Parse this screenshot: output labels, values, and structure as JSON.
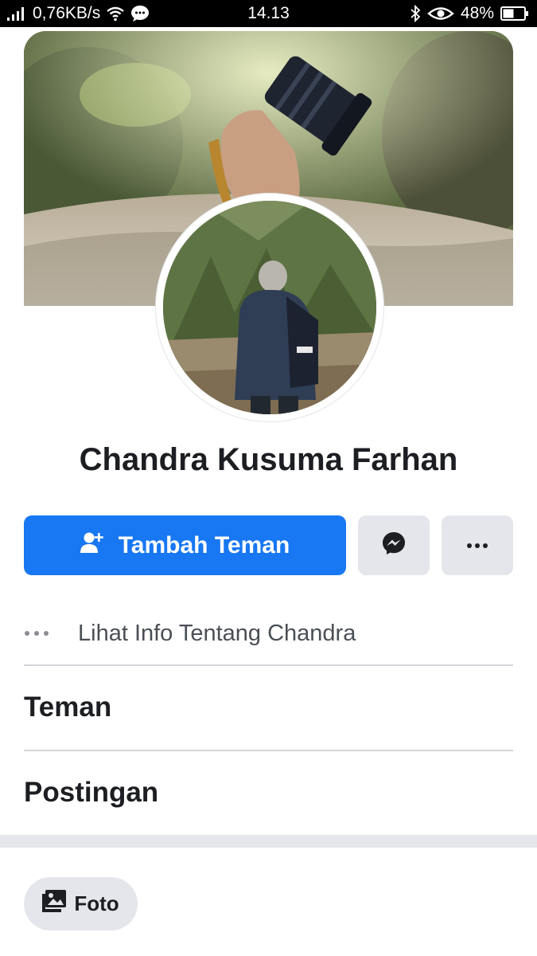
{
  "status_bar": {
    "network_speed": "0,76KB/s",
    "time": "14.13",
    "battery": "48%"
  },
  "profile": {
    "name": "Chandra Kusuma Farhan"
  },
  "actions": {
    "add_friend_label": "Tambah Teman",
    "messenger_icon": "messenger-icon",
    "more_icon": "more-options-icon"
  },
  "info": {
    "label": "Lihat Info Tentang Chandra"
  },
  "sections": {
    "friends": "Teman",
    "posts": "Postingan"
  },
  "filters": {
    "photo_label": "Foto"
  },
  "colors": {
    "primary_blue": "#1877f2",
    "button_gray": "#e4e6eb",
    "text_dark": "#1c1e21"
  }
}
